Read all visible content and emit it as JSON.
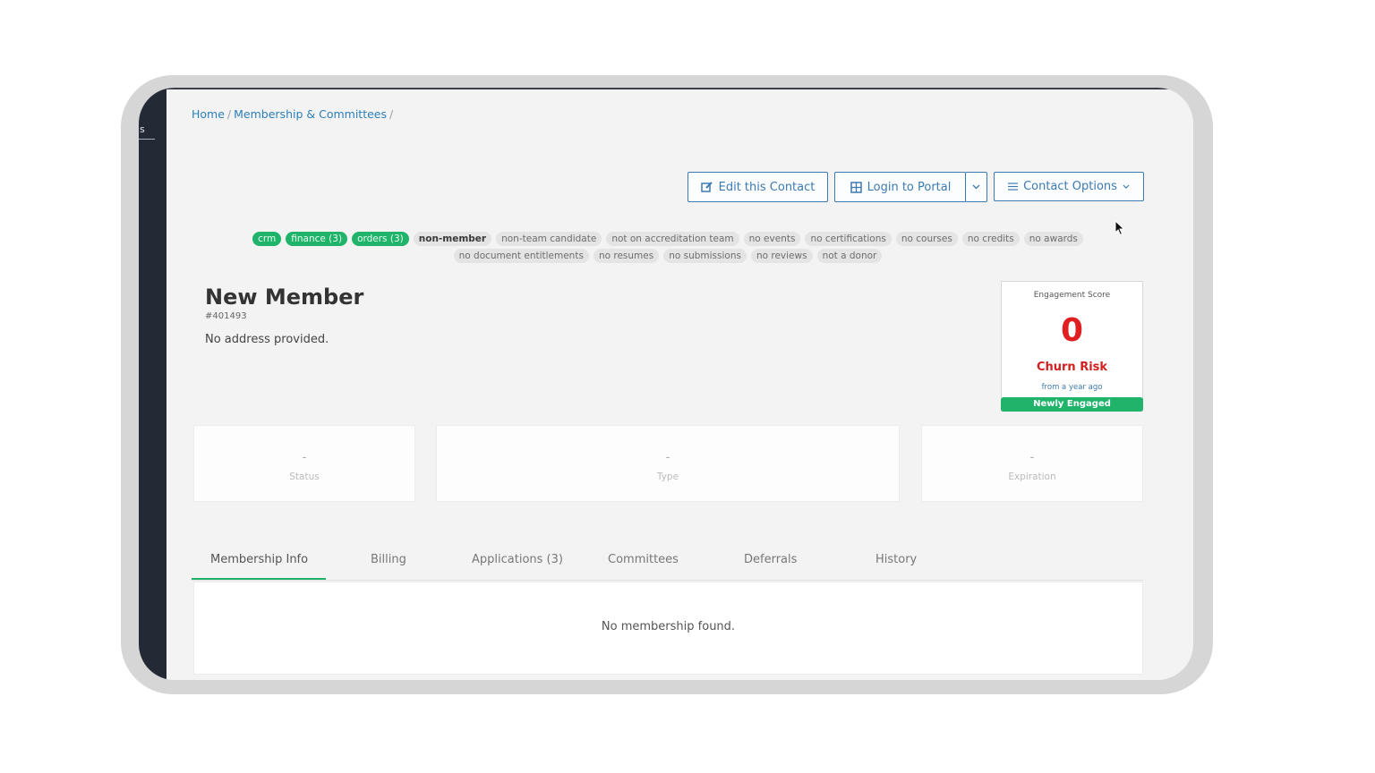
{
  "sidebar": {
    "label": "s"
  },
  "breadcrumb": {
    "items": [
      "Home",
      "Membership & Committees"
    ],
    "separator": "/"
  },
  "toolbar": {
    "edit_label": "Edit this Contact",
    "login_label": "Login to Portal",
    "options_label": "Contact Options"
  },
  "tags": {
    "row1": [
      {
        "label": "crm",
        "style": "green"
      },
      {
        "label": "finance (3)",
        "style": "green"
      },
      {
        "label": "orders (3)",
        "style": "green"
      },
      {
        "label": "non-member",
        "style": "dark"
      },
      {
        "label": "non-team candidate",
        "style": "grey"
      },
      {
        "label": "not on accreditation team",
        "style": "grey"
      },
      {
        "label": "no events",
        "style": "grey"
      },
      {
        "label": "no certifications",
        "style": "grey"
      },
      {
        "label": "no courses",
        "style": "grey"
      },
      {
        "label": "no credits",
        "style": "grey"
      },
      {
        "label": "no awards",
        "style": "grey"
      }
    ],
    "row2": [
      {
        "label": "no document entitlements",
        "style": "grey"
      },
      {
        "label": "no resumes",
        "style": "grey"
      },
      {
        "label": "no submissions",
        "style": "grey"
      },
      {
        "label": "no reviews",
        "style": "grey"
      },
      {
        "label": "not a donor",
        "style": "grey"
      }
    ]
  },
  "contact": {
    "name": "New Member",
    "id": "#401493",
    "address": "No address provided."
  },
  "engagement": {
    "label": "Engagement Score",
    "score": "0",
    "risk": "Churn Risk",
    "since": "from a year ago",
    "badge": "Newly Engaged",
    "score_color": "#e02020",
    "badge_color": "#1fb46a"
  },
  "stats": [
    {
      "value": "-",
      "label": "Status"
    },
    {
      "value": "-",
      "label": "Type"
    },
    {
      "value": "-",
      "label": "Expiration"
    }
  ],
  "tabs": [
    {
      "label": "Membership Info",
      "active": true
    },
    {
      "label": "Billing"
    },
    {
      "label": "Applications (3)"
    },
    {
      "label": "Committees"
    },
    {
      "label": "Deferrals"
    },
    {
      "label": "History"
    }
  ],
  "panel": {
    "message": "No membership found."
  },
  "icons": {
    "edit": "edit-icon",
    "login": "grid-icon",
    "dropdown": "chevron-down-icon",
    "options": "menu-icon",
    "cursor": "mouse-pointer-icon"
  },
  "colors": {
    "accent": "#3d7ab0",
    "green": "#1fb46a",
    "sidebar": "#232a36"
  }
}
